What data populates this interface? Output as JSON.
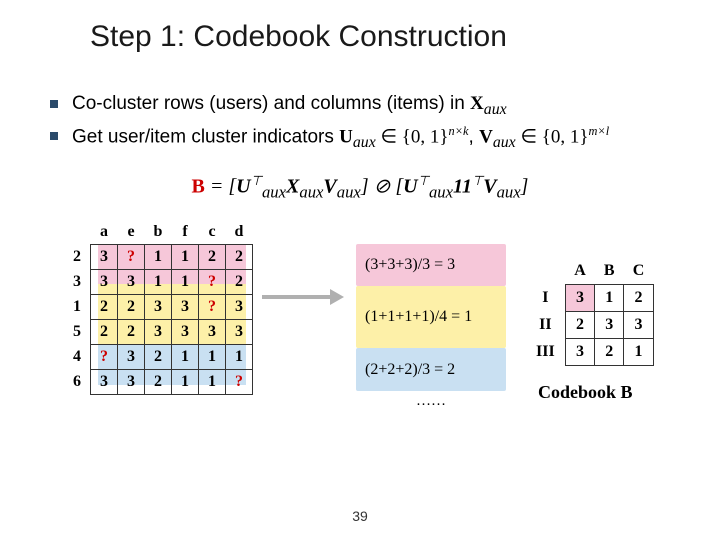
{
  "title": "Step 1: Codebook Construction",
  "bullets": {
    "b1_a": "Co-cluster rows (users) and columns (items) in ",
    "b1_var": "X",
    "b1_sub": "aux",
    "b2_a": "Get user/item cluster indicators ",
    "b2_U": "U",
    "b2_aux1": "aux",
    "b2_in1": " ∈ {0, 1}",
    "b2_nk": "n×k",
    "b2_comma": ", ",
    "b2_V": "V",
    "b2_aux2": "aux",
    "b2_in2": " ∈ {0, 1}",
    "b2_ml": "m×l"
  },
  "formula": {
    "B": "B",
    "eq": " = [",
    "U": "U",
    "utsup": "⊤",
    "utsub": "aux",
    "X": "X",
    "xsub": "aux",
    "V": "V",
    "vsub": "aux",
    "mid": "] ⊘ [",
    "U2": "U",
    "u2sup": "⊤",
    "u2sub": "aux",
    "ones": "11",
    "onesup": "⊤",
    "V2": "V",
    "v2sub": "aux",
    "end": "]"
  },
  "leftTable": {
    "cols": [
      "a",
      "e",
      "b",
      "f",
      "c",
      "d"
    ],
    "rows": [
      {
        "h": "2",
        "c": [
          "3",
          "?",
          "1",
          "1",
          "2",
          "2"
        ]
      },
      {
        "h": "3",
        "c": [
          "3",
          "3",
          "1",
          "1",
          "?",
          "2"
        ]
      },
      {
        "h": "1",
        "c": [
          "2",
          "2",
          "3",
          "3",
          "?",
          "3"
        ]
      },
      {
        "h": "5",
        "c": [
          "2",
          "2",
          "3",
          "3",
          "3",
          "3"
        ]
      },
      {
        "h": "4",
        "c": [
          "?",
          "3",
          "2",
          "1",
          "1",
          "1"
        ]
      },
      {
        "h": "6",
        "c": [
          "3",
          "3",
          "2",
          "1",
          "1",
          "?"
        ]
      }
    ]
  },
  "calc": {
    "l1": "(3+3+3)/3 = 3",
    "l2": "(1+1+1+1)/4 = 1",
    "l3": "(2+2+2)/3 = 2",
    "dots": "……"
  },
  "rightTable": {
    "cols": [
      "A",
      "B",
      "C"
    ],
    "rows": [
      {
        "h": "I",
        "c": [
          "3",
          "1",
          "2"
        ]
      },
      {
        "h": "II",
        "c": [
          "2",
          "3",
          "3"
        ]
      },
      {
        "h": "III",
        "c": [
          "3",
          "2",
          "1"
        ]
      }
    ]
  },
  "codebookLabel": "Codebook B",
  "pageNum": "39"
}
